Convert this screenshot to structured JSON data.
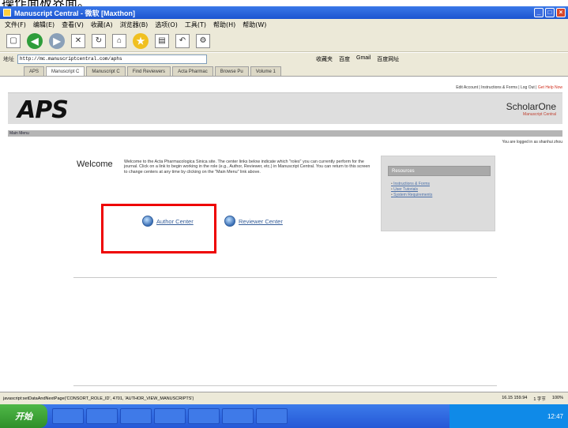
{
  "caption": "操作面板界面。",
  "window": {
    "title": "Manuscript Central - 微软 [Maxthon]"
  },
  "menubar": {
    "items": [
      "文件(F)",
      "编辑(E)",
      "查看(V)",
      "收藏(A)",
      "浏览器(B)",
      "选项(O)",
      "工具(T)",
      "帮助(H)",
      "帮助(W)"
    ]
  },
  "address": {
    "label": "地址",
    "url": "http://mc.manuscriptcentral.com/aphs",
    "bookmarks": [
      "收藏夹",
      "百度",
      "Gmail",
      "百度网址"
    ]
  },
  "tabs": [
    "APS",
    "Manuscript C",
    "Manuscript C",
    "Find Reviewers",
    "Acta Pharmac",
    "Browse Pu",
    "Volume 1"
  ],
  "site": {
    "top_links": "Edit Account  |  Instructions & Forms  |  Log Out  |  ",
    "help_link": "Get Help Now",
    "logo": "APS",
    "brand_name": "ScholarOne",
    "brand_sub": "Manuscript Central",
    "nav_label": "Main Menu",
    "logged_in": "You are logged in as shanhui zhou"
  },
  "welcome": {
    "title": "Welcome",
    "text": "Welcome to the Acta Pharmacologica Sinica site. The center links below indicate which \"roles\" you can currently perform for the journal. Click on a link to begin working in the role (e.g., Author, Reviewer, etc.) in Manuscript Central. You can return to this screen to change centers at any time by clicking on the \"Main Menu\" link above."
  },
  "centers": {
    "author": "Author Center",
    "reviewer": "Reviewer Center"
  },
  "resources": {
    "title": "Resources",
    "links": [
      "Instructions & Forms",
      "User Tutorials",
      "System Requirements"
    ]
  },
  "statusbar": {
    "text": "javascript:setDataAndNextPage('CONSORT_ROLE_ID', 4701, 'AUTHOR_VIEW_MANUSCRIPTS')",
    "right_items": [
      "16.15 159.94",
      "1 字节",
      "100%"
    ]
  },
  "taskbar": {
    "start_label": "开始",
    "clock": "12:47"
  }
}
